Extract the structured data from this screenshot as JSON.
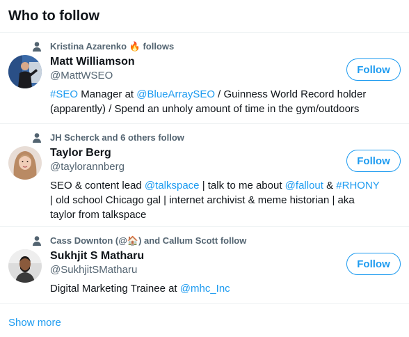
{
  "header": {
    "title": "Who to follow"
  },
  "suggestions": [
    {
      "social_context": "Kristina Azarenko 🔥 follows",
      "name": "Matt Williamson",
      "handle": "@MattWSEO",
      "follow_label": "Follow",
      "bio": [
        {
          "text": "#SEO",
          "link": true
        },
        {
          "text": " Manager at ",
          "link": false
        },
        {
          "text": "@BlueArraySEO",
          "link": true
        },
        {
          "text": " / Guinness World Record holder (apparently) / Spend an unholy amount of time in the gym/outdoors",
          "link": false
        }
      ]
    },
    {
      "social_context": "JH Scherck and 6 others follow",
      "name": "Taylor Berg",
      "handle": "@taylorannberg",
      "follow_label": "Follow",
      "bio": [
        {
          "text": "SEO & content lead ",
          "link": false
        },
        {
          "text": "@talkspace",
          "link": true
        },
        {
          "text": " | talk to me about ",
          "link": false
        },
        {
          "text": "@fallout",
          "link": true
        },
        {
          "text": " & ",
          "link": false
        },
        {
          "text": "#RHONY",
          "link": true
        },
        {
          "text": " | old school Chicago gal | internet archivist & meme historian | aka taylor from talkspace",
          "link": false
        }
      ]
    },
    {
      "social_context": "Cass Downton (@🏠) and Callum Scott follow",
      "name": "Sukhjit S Matharu",
      "handle": "@SukhjitSMatharu",
      "follow_label": "Follow",
      "bio": [
        {
          "text": "Digital Marketing Trainee at ",
          "link": false
        },
        {
          "text": "@mhc_Inc",
          "link": true
        }
      ]
    }
  ],
  "footer": {
    "show_more": "Show more"
  },
  "colors": {
    "accent": "#1d9bf0",
    "secondary_text": "#536471",
    "divider": "#eff3f4"
  },
  "icons": {
    "social_context": "person-icon"
  }
}
